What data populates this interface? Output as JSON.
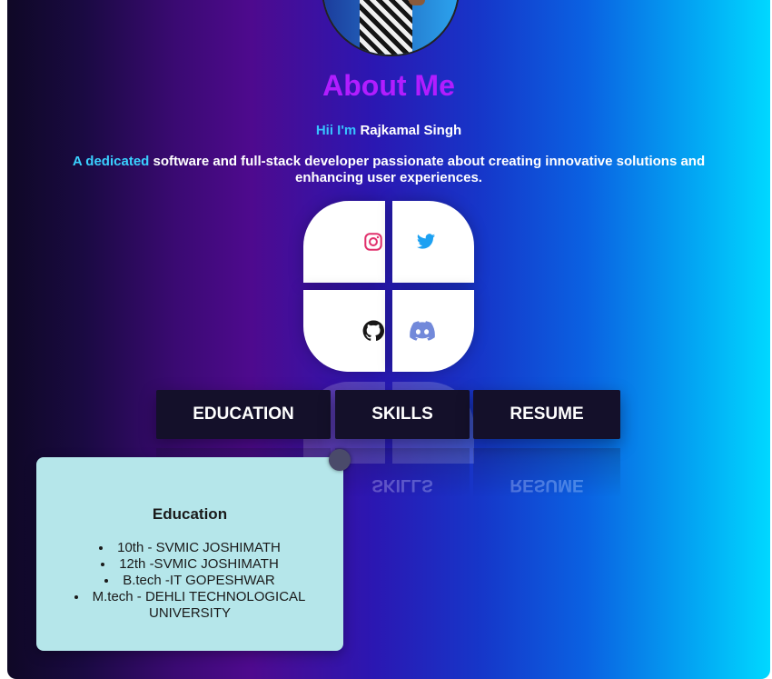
{
  "profile": {
    "title": "About Me",
    "greeting_prefix": "Hii I'm",
    "name": "Rajkamal Singh",
    "bio_highlight": "A dedicated",
    "bio_rest": "software and full-stack developer passionate about creating innovative solutions and enhancing user experiences."
  },
  "social": {
    "icons": [
      "instagram-icon",
      "twitter-icon",
      "github-icon",
      "discord-icon"
    ]
  },
  "nav": {
    "education": "EDUCATION",
    "skills": "SKILLS",
    "resume": "RESUME"
  },
  "education_card": {
    "title": "Education",
    "items": [
      "10th - SVMIC JOSHIMATH",
      "12th -SVMIC JOSHIMATH",
      "B.tech -IT GOPESHWAR",
      "M.tech - DEHLI TECHNOLOGICAL UNIVERSITY"
    ]
  },
  "colors": {
    "title": "#b11dff",
    "accent": "#37c2ff",
    "instagram": "#e1306c",
    "twitter": "#1da1f2",
    "github": "#181717",
    "discord": "#7289da",
    "card_bg": "#b5e6ea",
    "nav_bg": "#14102a"
  }
}
